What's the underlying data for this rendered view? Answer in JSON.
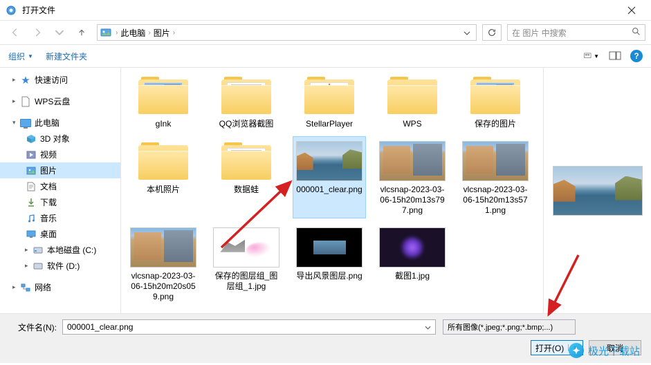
{
  "titlebar": {
    "title": "打开文件"
  },
  "nav": {
    "path": {
      "root": "此电脑",
      "folder": "图片"
    },
    "search_placeholder": "在 图片 中搜索"
  },
  "toolbar": {
    "organize": "组织",
    "new_folder": "新建文件夹"
  },
  "sidebar": {
    "quick_access": "快速访问",
    "wps_cloud": "WPS云盘",
    "this_pc": "此电脑",
    "objects_3d": "3D 对象",
    "videos": "视频",
    "pictures": "图片",
    "documents": "文档",
    "downloads": "下载",
    "music": "音乐",
    "desktop": "桌面",
    "local_c": "本地磁盘 (C:)",
    "soft_d": "软件 (D:)",
    "network": "网络"
  },
  "files": [
    {
      "name": "gInk",
      "type": "folder",
      "content": "italian"
    },
    {
      "name": "QQ浏览器截图",
      "type": "folder",
      "content": "doc"
    },
    {
      "name": "StellarPlayer",
      "type": "folder",
      "content": "vlc"
    },
    {
      "name": "WPS",
      "type": "folder",
      "content": "empty"
    },
    {
      "name": "保存的图片",
      "type": "folder",
      "content": "italian"
    },
    {
      "name": "本机照片",
      "type": "folder",
      "content": "empty"
    },
    {
      "name": "数据蛙",
      "type": "folder",
      "content": "doc"
    },
    {
      "name": "000001_clear.png",
      "type": "image",
      "thumb": "lake",
      "selected": true
    },
    {
      "name": "vlcsnap-2023-03-06-15h20m13s797.png",
      "type": "image",
      "thumb": "italian"
    },
    {
      "name": "vlcsnap-2023-03-06-15h20m13s571.png",
      "type": "image",
      "thumb": "italian"
    },
    {
      "name": "vlcsnap-2023-03-06-15h20m20s059.png",
      "type": "image",
      "thumb": "italian"
    },
    {
      "name": "保存的图层组_图层组_1.jpg",
      "type": "image",
      "thumb": "sketch"
    },
    {
      "name": "导出风景图层.png",
      "type": "image",
      "thumb": "black-center"
    },
    {
      "name": "截图1.jpg",
      "type": "image",
      "thumb": "galaxy"
    }
  ],
  "footer": {
    "label": "文件名(N):",
    "filename": "000001_clear.png",
    "filetype": "所有图像(*.jpeg;*.png;*.bmp;...)",
    "open_btn": "打开(O)",
    "cancel_btn": "取消"
  },
  "watermark": "极光下载站"
}
